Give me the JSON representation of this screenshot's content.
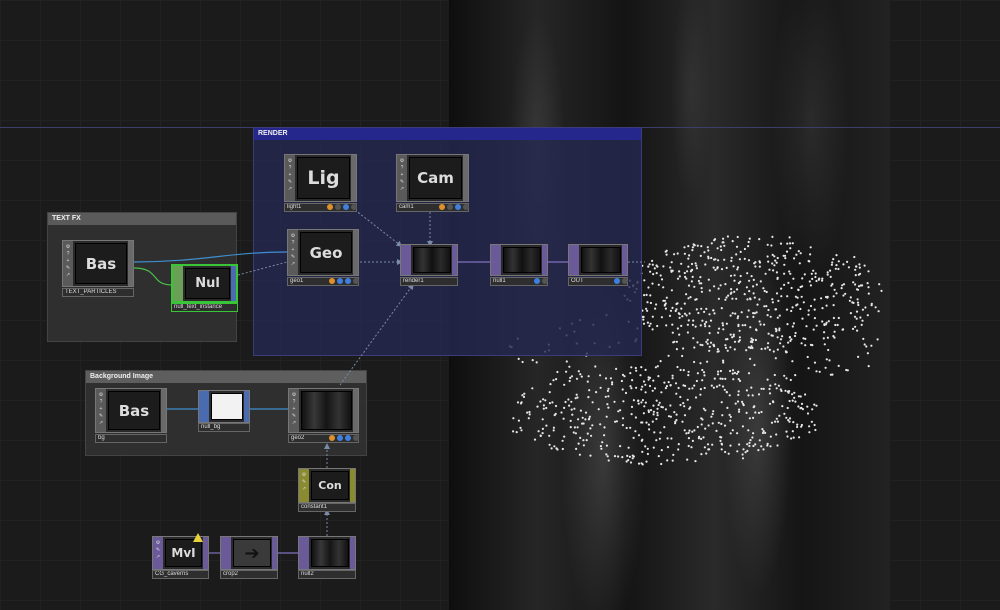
{
  "network": {
    "boxes": {
      "render": "RENDER",
      "text_fx": "TEXT FX",
      "background_image": "Background Image"
    },
    "nodes": [
      {
        "id": "light1",
        "thumb": "Lig",
        "label": "light1",
        "family": "COMP"
      },
      {
        "id": "cam1",
        "thumb": "Cam",
        "label": "cam1",
        "family": "COMP"
      },
      {
        "id": "geo1",
        "thumb": "Geo",
        "label": "geo1",
        "family": "COMP"
      },
      {
        "id": "render1",
        "thumb": "",
        "label": "render1",
        "family": "TOP"
      },
      {
        "id": "null1",
        "thumb": "",
        "label": "null1",
        "family": "TOP"
      },
      {
        "id": "out",
        "thumb": "",
        "label": "OUT",
        "family": "TOP"
      },
      {
        "id": "text_particles",
        "thumb": "Bas",
        "label": "TEXT_PARTICLES",
        "family": "COMP"
      },
      {
        "id": "null_text_instance",
        "thumb": "Nul",
        "label": "null_text_instance",
        "family": "CHOP",
        "selected": true
      },
      {
        "id": "bg",
        "thumb": "Bas",
        "label": "bg",
        "family": "COMP"
      },
      {
        "id": "null_bg",
        "thumb": "",
        "label": "null_bg",
        "family": "CHOP"
      },
      {
        "id": "geo2",
        "thumb": "",
        "label": "geo2",
        "family": "COMP"
      },
      {
        "id": "constant1",
        "thumb": "Con",
        "label": "constant1",
        "family": "DAT"
      },
      {
        "id": "cg_caverns",
        "thumb": "MvI",
        "label": "CG_caverns",
        "family": "TOP",
        "warning": true
      },
      {
        "id": "crop2",
        "thumb": "➔",
        "label": "crop2",
        "family": "TOP"
      },
      {
        "id": "null2",
        "thumb": "",
        "label": "null2",
        "family": "TOP"
      }
    ],
    "strip_icons": [
      "⚙",
      "?",
      "+",
      "✎",
      "↗"
    ],
    "colors": {
      "comp": "#5a5a5a",
      "top": "#6a5a9a",
      "chop": "#4a6bb0",
      "dat": "#8a8a30",
      "selected": "#38c638",
      "flag_orange": "#e0902a",
      "flag_blue": "#3f7fe0",
      "render_box": "#26278c"
    }
  }
}
